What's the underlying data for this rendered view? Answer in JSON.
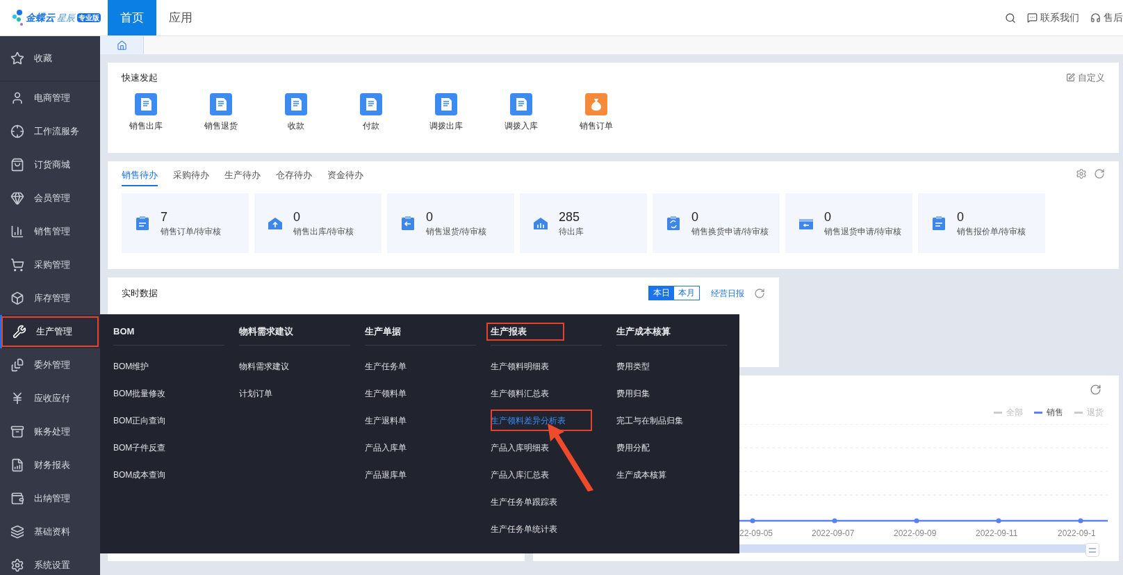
{
  "header": {
    "logo": {
      "name": "金蝶云",
      "sub": "星辰",
      "badge": "专业版"
    },
    "nav": [
      {
        "label": "首页",
        "selected": true
      },
      {
        "label": "应用",
        "selected": false
      }
    ],
    "actions": [
      {
        "label": "联系我们"
      },
      {
        "label": "售后"
      }
    ]
  },
  "sidebar": {
    "items": [
      {
        "label": "收藏",
        "selected": false,
        "annotated": false
      },
      {
        "label": "电商管理",
        "selected": false,
        "annotated": false
      },
      {
        "label": "工作流服务",
        "selected": false,
        "annotated": false
      },
      {
        "label": "订货商城",
        "selected": false,
        "annotated": false
      },
      {
        "label": "会员管理",
        "selected": false,
        "annotated": false
      },
      {
        "label": "销售管理",
        "selected": false,
        "annotated": false
      },
      {
        "label": "采购管理",
        "selected": false,
        "annotated": false
      },
      {
        "label": "库存管理",
        "selected": false,
        "annotated": false
      },
      {
        "label": "生产管理",
        "selected": true,
        "annotated": true
      },
      {
        "label": "委外管理",
        "selected": false,
        "annotated": false
      },
      {
        "label": "应收应付",
        "selected": false,
        "annotated": false
      },
      {
        "label": "账务处理",
        "selected": false,
        "annotated": false
      },
      {
        "label": "财务报表",
        "selected": false,
        "annotated": false
      },
      {
        "label": "出纳管理",
        "selected": false,
        "annotated": false
      },
      {
        "label": "基础资料",
        "selected": false,
        "annotated": false
      },
      {
        "label": "系统设置",
        "selected": false,
        "annotated": false
      }
    ]
  },
  "quick_start": {
    "title": "快速发起",
    "customize": "自定义",
    "items": [
      {
        "label": "销售出库",
        "kind": "doc"
      },
      {
        "label": "销售退货",
        "kind": "doc"
      },
      {
        "label": "收款",
        "kind": "doc"
      },
      {
        "label": "付款",
        "kind": "doc"
      },
      {
        "label": "调拨出库",
        "kind": "doc"
      },
      {
        "label": "调拨入库",
        "kind": "doc"
      },
      {
        "label": "销售订单",
        "kind": "money"
      }
    ]
  },
  "todo": {
    "tabs": [
      {
        "label": "销售待办",
        "selected": true
      },
      {
        "label": "采购待办",
        "selected": false
      },
      {
        "label": "生产待办",
        "selected": false
      },
      {
        "label": "仓存待办",
        "selected": false
      },
      {
        "label": "资金待办",
        "selected": false
      }
    ],
    "cards": [
      {
        "count": "7",
        "label": "销售订单/待审核"
      },
      {
        "count": "0",
        "label": "销售出库/待审核"
      },
      {
        "count": "0",
        "label": "销售退货/待审核"
      },
      {
        "count": "285",
        "label": "待出库"
      },
      {
        "count": "0",
        "label": "销售换货申请/待审核"
      },
      {
        "count": "0",
        "label": "销售退货申请/待审核"
      },
      {
        "count": "0",
        "label": "销售报价单/待审核"
      }
    ]
  },
  "realtime": {
    "title": "实时数据",
    "ranges": [
      {
        "label": "本日",
        "selected": true
      },
      {
        "label": "本月",
        "selected": false
      }
    ],
    "link": "经营日报"
  },
  "trend": {
    "legend": [
      {
        "label": "全部",
        "selected": false
      },
      {
        "label": "销售",
        "selected": true
      },
      {
        "label": "退货",
        "selected": false
      }
    ],
    "range_slider": {
      "level": 1
    },
    "x_labels": [
      "22-09-05",
      "2022-09-07",
      "2022-09-09",
      "2022-09-11",
      "2022-09-1"
    ]
  },
  "mega_menu": {
    "columns": [
      {
        "title": "BOM",
        "annotated": false,
        "items": [
          {
            "label": "BOM维护",
            "selected": false,
            "annotated": false
          },
          {
            "label": "BOM批量修改",
            "selected": false,
            "annotated": false
          },
          {
            "label": "BOM正向查询",
            "selected": false,
            "annotated": false
          },
          {
            "label": "BOM子件反查",
            "selected": false,
            "annotated": false
          },
          {
            "label": "BOM成本查询",
            "selected": false,
            "annotated": false
          }
        ]
      },
      {
        "title": "物料需求建议",
        "annotated": false,
        "items": [
          {
            "label": "物料需求建议",
            "selected": false,
            "annotated": false
          },
          {
            "label": "计划订单",
            "selected": false,
            "annotated": false
          }
        ]
      },
      {
        "title": "生产单据",
        "annotated": false,
        "items": [
          {
            "label": "生产任务单",
            "selected": false,
            "annotated": false
          },
          {
            "label": "生产领料单",
            "selected": false,
            "annotated": false
          },
          {
            "label": "生产退料单",
            "selected": false,
            "annotated": false
          },
          {
            "label": "产品入库单",
            "selected": false,
            "annotated": false
          },
          {
            "label": "产品退库单",
            "selected": false,
            "annotated": false
          }
        ]
      },
      {
        "title": "生产报表",
        "annotated": true,
        "items": [
          {
            "label": "生产领料明细表",
            "selected": false,
            "annotated": false
          },
          {
            "label": "生产领料汇总表",
            "selected": false,
            "annotated": false
          },
          {
            "label": "生产领料差异分析表",
            "selected": true,
            "annotated": true
          },
          {
            "label": "产品入库明细表",
            "selected": false,
            "annotated": false
          },
          {
            "label": "产品入库汇总表",
            "selected": false,
            "annotated": false
          },
          {
            "label": "生产任务单跟踪表",
            "selected": false,
            "annotated": false
          },
          {
            "label": "生产任务单统计表",
            "selected": false,
            "annotated": false
          }
        ]
      },
      {
        "title": "生产成本核算",
        "annotated": false,
        "items": [
          {
            "label": "费用类型",
            "selected": false,
            "annotated": false
          },
          {
            "label": "费用归集",
            "selected": false,
            "annotated": false
          },
          {
            "label": "完工与在制品归集",
            "selected": false,
            "annotated": false
          },
          {
            "label": "费用分配",
            "selected": false,
            "annotated": false
          },
          {
            "label": "生产成本核算",
            "selected": false,
            "annotated": false
          }
        ]
      }
    ]
  }
}
